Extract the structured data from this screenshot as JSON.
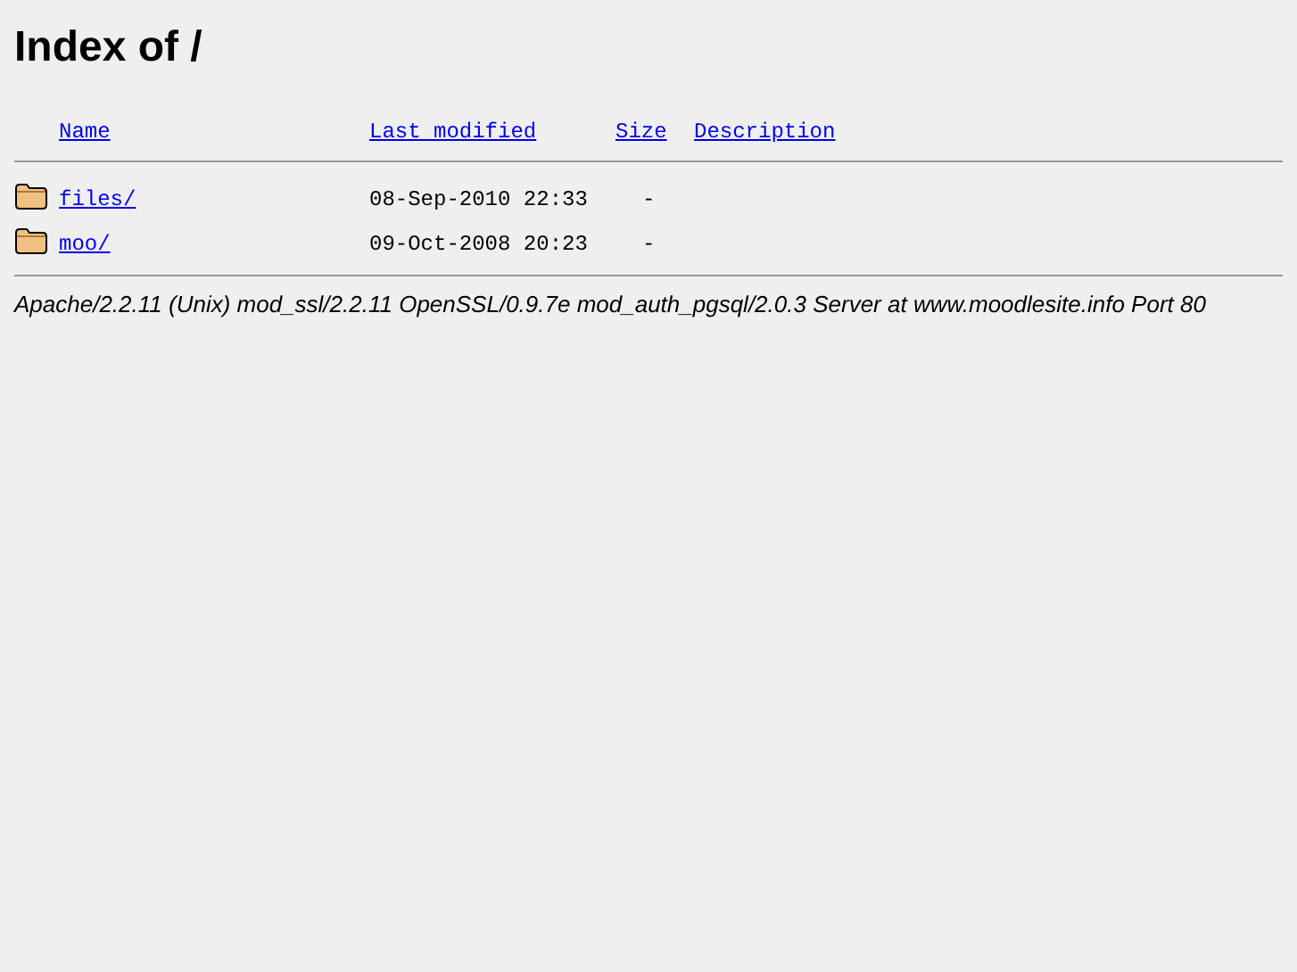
{
  "title": "Index of /",
  "columns": [
    "Name",
    "Last modified",
    "Size",
    "Description"
  ],
  "rows": [
    {
      "name": "files/",
      "modified": "08-Sep-2010 22:33",
      "size": "-"
    },
    {
      "name": "moo/",
      "modified": "09-Oct-2008 20:23",
      "size": "-"
    }
  ],
  "address": "Apache/2.2.11 (Unix) mod_ssl/2.2.11 OpenSSL/0.9.7e mod_auth_pgsql/2.0.3 Server at www.moodlesite.info Port 80"
}
